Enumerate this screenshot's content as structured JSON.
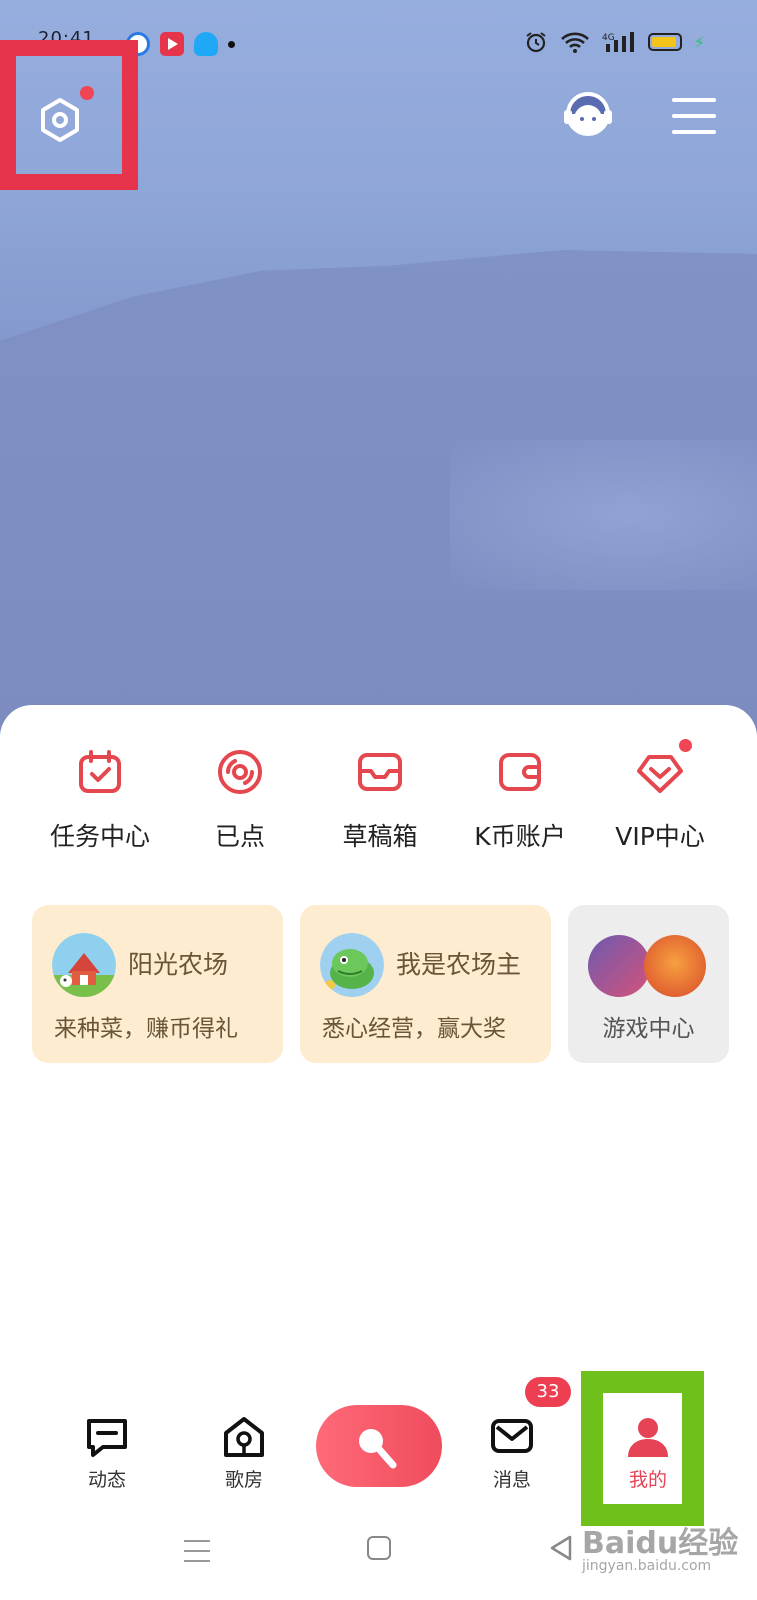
{
  "status_bar": {
    "time": "20:41",
    "notification_icons": [
      "browser-icon",
      "video-app-icon",
      "qq-icon",
      "more-dot-icon"
    ],
    "system_icons": [
      "alarm-icon",
      "wifi-icon",
      "4g-signal-icon",
      "battery-icon",
      "charging-icon"
    ],
    "network_label": "4G"
  },
  "header": {
    "settings_has_dot": true,
    "icons": [
      "settings-icon",
      "avatar-icon",
      "menu-icon"
    ]
  },
  "shortcuts": [
    {
      "label": "任务中心",
      "icon": "task-calendar-icon"
    },
    {
      "label": "已点",
      "icon": "disc-icon"
    },
    {
      "label": "草稿箱",
      "icon": "draft-box-icon"
    },
    {
      "label": "K币账户",
      "icon": "wallet-icon"
    },
    {
      "label": "VIP中心",
      "icon": "vip-diamond-icon",
      "has_dot": true
    }
  ],
  "cards": [
    {
      "title": "阳光农场",
      "subtitle": "来种菜，赚币得礼"
    },
    {
      "title": "我是农场主",
      "subtitle": "悉心经营，赢大奖"
    },
    {
      "title": "",
      "subtitle": "游戏中心"
    }
  ],
  "bottom_nav": [
    {
      "label": "动态",
      "icon": "feed-icon"
    },
    {
      "label": "歌房",
      "icon": "song-room-icon"
    },
    {
      "label": "",
      "icon": "microphone-icon"
    },
    {
      "label": "消息",
      "icon": "message-icon",
      "badge": "33"
    },
    {
      "label": "我的",
      "icon": "profile-icon",
      "active": true
    }
  ],
  "watermark": {
    "text": "Baidu经验",
    "sub": "jingyan.baidu.com"
  },
  "colors": {
    "accent": "#e64356",
    "highlight_red": "#e5344b",
    "highlight_green": "#6fc01a",
    "card_bg": "#fdecd0"
  }
}
